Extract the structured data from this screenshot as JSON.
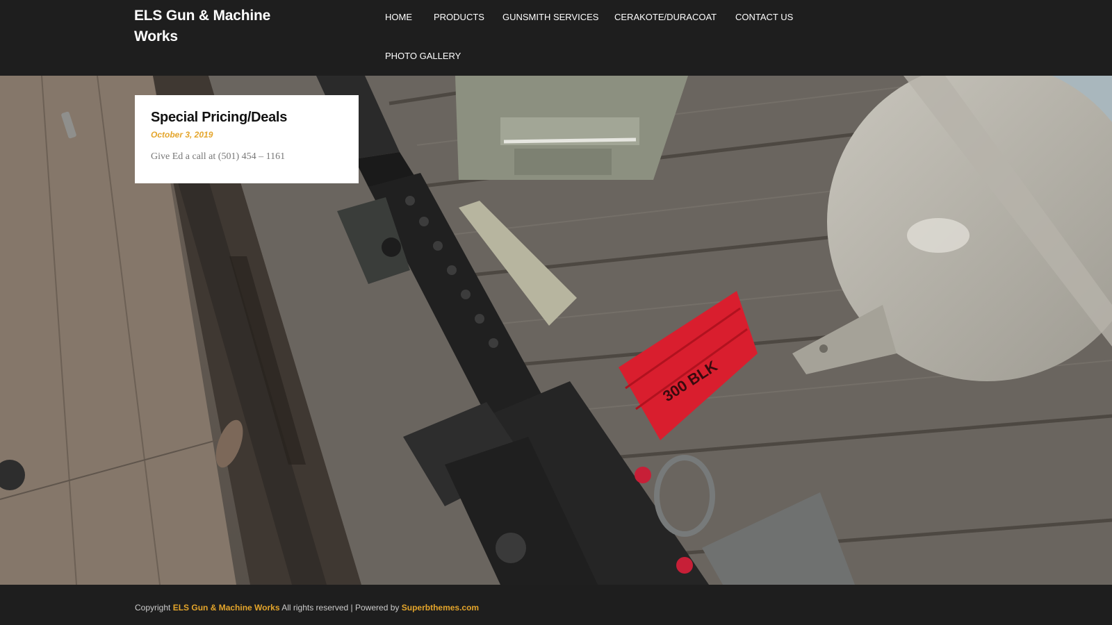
{
  "header": {
    "site_title": "ELS Gun & Machine Works",
    "nav": [
      {
        "label": "HOME"
      },
      {
        "label": "PRODUCTS"
      },
      {
        "label": "GUNSMITH SERVICES"
      },
      {
        "label": "CERAKOTE/DURACOAT"
      },
      {
        "label": "CONTACT US"
      },
      {
        "label": "PHOTO GALLERY"
      }
    ]
  },
  "post": {
    "title": "Special Pricing/Deals",
    "date": "October 3, 2019",
    "excerpt": "Give Ed a call at (501) 454 – 1161"
  },
  "hero": {
    "magazine_text": "300 BLK"
  },
  "footer": {
    "copyright_prefix": "Copyright",
    "site_link": "ELS Gun & Machine Works",
    "rights_text": "All rights reserved | Powered by",
    "powered_link": "Superbthemes.com"
  },
  "colors": {
    "header_bg": "#1e1e1e",
    "accent": "#e4a52b",
    "card_bg": "#ffffff"
  }
}
